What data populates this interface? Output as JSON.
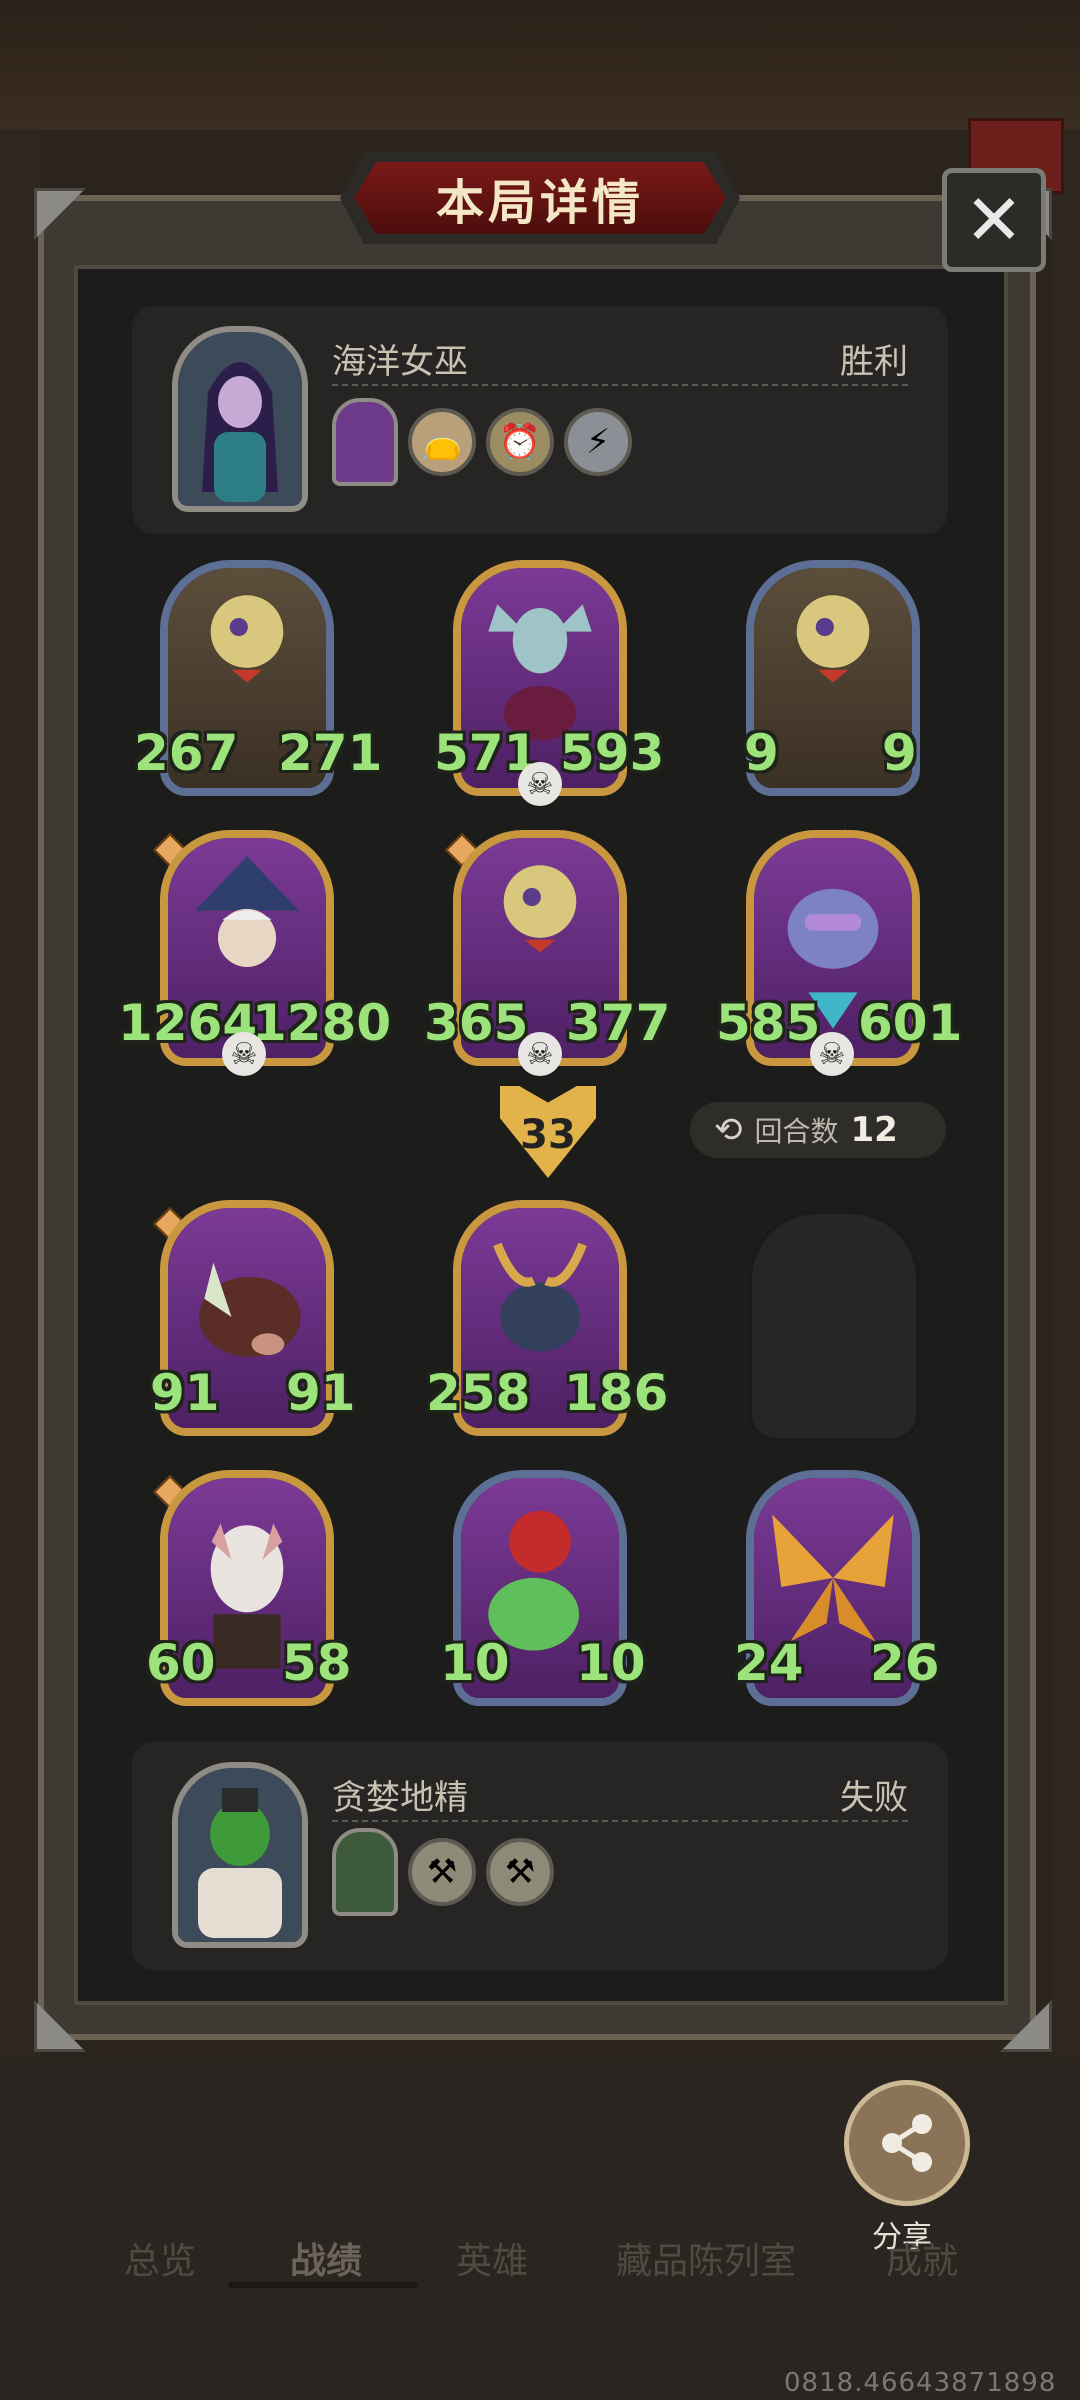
{
  "header": {
    "title": "本局详情",
    "close_icon": "close-icon"
  },
  "player_top": {
    "name": "海洋女巫",
    "result": "胜利",
    "trinkets": [
      "treasure-bag-icon",
      "cuckoo-clock-icon",
      "lightning-orb-icon"
    ]
  },
  "player_bottom": {
    "name": "贪婪地精",
    "result": "失败",
    "trinkets": [
      "axe-weapon-icon",
      "axe-weapon-icon"
    ]
  },
  "board_top": [
    {
      "attack": "267",
      "health": "271",
      "frame": "blue",
      "gem": false,
      "skull": false
    },
    {
      "attack": "571",
      "health": "593",
      "frame": "gold",
      "gem": false,
      "skull": true
    },
    {
      "attack": "9",
      "health": "9",
      "frame": "blue",
      "gem": false,
      "skull": false
    },
    {
      "attack": "1264",
      "health": "1280",
      "frame": "gold",
      "gem": true,
      "skull": true
    },
    {
      "attack": "365",
      "health": "377",
      "frame": "gold",
      "gem": true,
      "skull": true
    },
    {
      "attack": "585",
      "health": "601",
      "frame": "gold",
      "gem": true,
      "skull": true
    }
  ],
  "damage_badge": "33",
  "turns": {
    "label": "回合数",
    "value": "12"
  },
  "board_bottom": [
    {
      "attack": "91",
      "health": "91",
      "frame": "gold",
      "gem": true
    },
    {
      "attack": "258",
      "health": "186",
      "frame": "gold",
      "gem": false
    },
    {
      "attack": "60",
      "health": "58",
      "frame": "gold",
      "gem": true
    },
    {
      "attack": "10",
      "health": "10",
      "frame": "blue",
      "gem": false
    },
    {
      "attack": "24",
      "health": "26",
      "frame": "blue",
      "gem": false
    }
  ],
  "share": {
    "label": "分享"
  },
  "nav": {
    "tabs": [
      "总览",
      "战绩",
      "英雄",
      "藏品陈列室",
      "成就"
    ],
    "active": "战绩"
  },
  "footer": {
    "code": "0818.46643871898"
  },
  "colors": {
    "stat_green": "#9be37a",
    "gold_frame": "#c8973f",
    "blue_frame": "#5e6f95"
  }
}
